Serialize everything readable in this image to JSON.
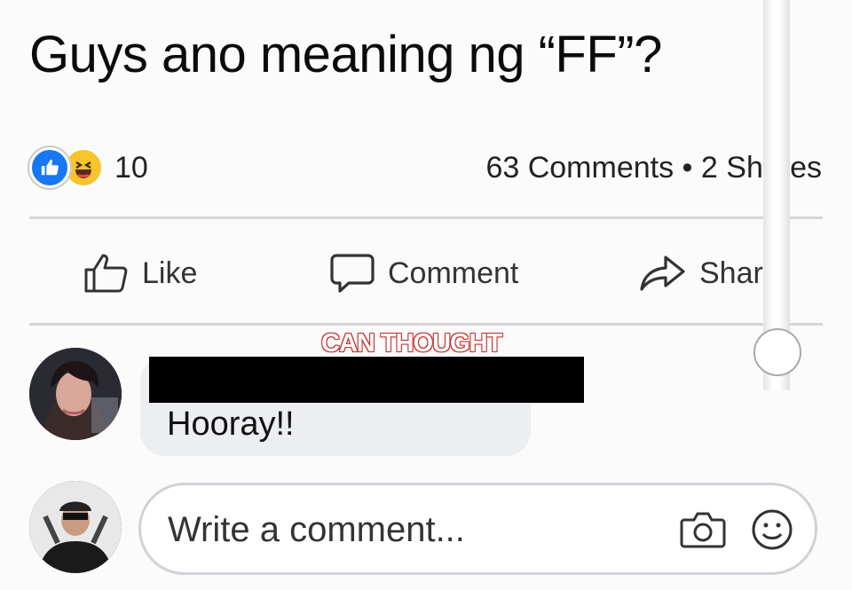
{
  "post": {
    "text": "Guys ano meaning ng “FF”?"
  },
  "reactions": {
    "count": "10",
    "icons": [
      "like-icon",
      "haha-icon"
    ]
  },
  "stats": {
    "comments": "63 Comments",
    "separator": "•",
    "shares": "2 Shares"
  },
  "actions": {
    "like": "Like",
    "comment": "Comment",
    "share": "Share"
  },
  "watermark": "CAN THOUGHT",
  "comment": {
    "text": "Hooray!!",
    "author_redacted": true
  },
  "composer": {
    "placeholder": "Write a comment..."
  },
  "colors": {
    "like_blue": "#1877f2",
    "haha_yellow": "#f7c42d",
    "bubble": "#eceef1",
    "watermark_red": "#c4312d"
  }
}
